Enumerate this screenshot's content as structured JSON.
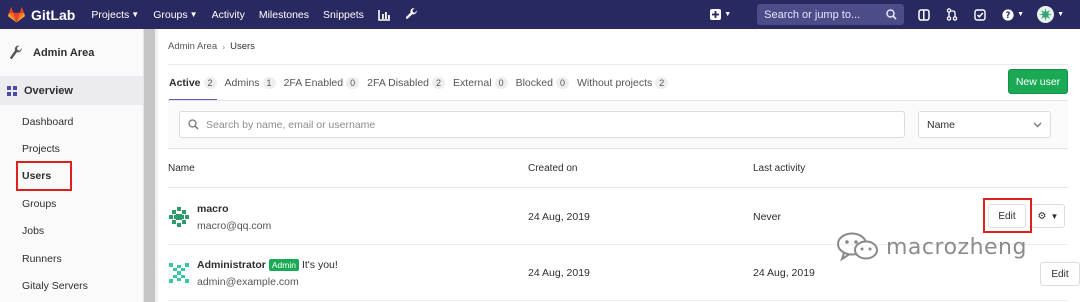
{
  "navbar": {
    "brand": "GitLab",
    "links": [
      {
        "label": "Projects",
        "dropdown": true
      },
      {
        "label": "Groups",
        "dropdown": true
      },
      {
        "label": "Activity",
        "dropdown": false
      },
      {
        "label": "Milestones",
        "dropdown": false
      },
      {
        "label": "Snippets",
        "dropdown": false
      }
    ],
    "search_placeholder": "Search or jump to...",
    "colors": {
      "bar": "#292961",
      "search": "#4c4c89"
    }
  },
  "sidebar": {
    "header": "Admin Area",
    "section": "Overview",
    "items": [
      {
        "label": "Dashboard"
      },
      {
        "label": "Projects"
      },
      {
        "label": "Users"
      },
      {
        "label": "Groups"
      },
      {
        "label": "Jobs"
      },
      {
        "label": "Runners"
      },
      {
        "label": "Gitaly Servers"
      }
    ],
    "active_item": "Users"
  },
  "breadcrumb": {
    "parent": "Admin Area",
    "current": "Users"
  },
  "tabs": [
    {
      "label": "Active",
      "count": "2"
    },
    {
      "label": "Admins",
      "count": "1"
    },
    {
      "label": "2FA Enabled",
      "count": "0"
    },
    {
      "label": "2FA Disabled",
      "count": "2"
    },
    {
      "label": "External",
      "count": "0"
    },
    {
      "label": "Blocked",
      "count": "0"
    },
    {
      "label": "Without projects",
      "count": "2"
    }
  ],
  "new_user_label": "New user",
  "filter": {
    "search_placeholder": "Search by name, email or username",
    "sort_value": "Name"
  },
  "table": {
    "headers": {
      "name": "Name",
      "created": "Created on",
      "activity": "Last activity"
    },
    "rows": [
      {
        "name": "macro",
        "email": "macro@qq.com",
        "created": "24 Aug, 2019",
        "last_activity": "Never",
        "edit_label": "Edit",
        "badge": "",
        "note": ""
      },
      {
        "name": "Administrator",
        "email": "admin@example.com",
        "created": "24 Aug, 2019",
        "last_activity": "24 Aug, 2019",
        "edit_label": "Edit",
        "badge": "Admin",
        "note": "It's you!"
      }
    ]
  },
  "watermark": "macrozheng",
  "accent_colors": {
    "green": "#1aaa55",
    "highlight": "#e0201f",
    "tab_active": "#6b4fbb"
  }
}
